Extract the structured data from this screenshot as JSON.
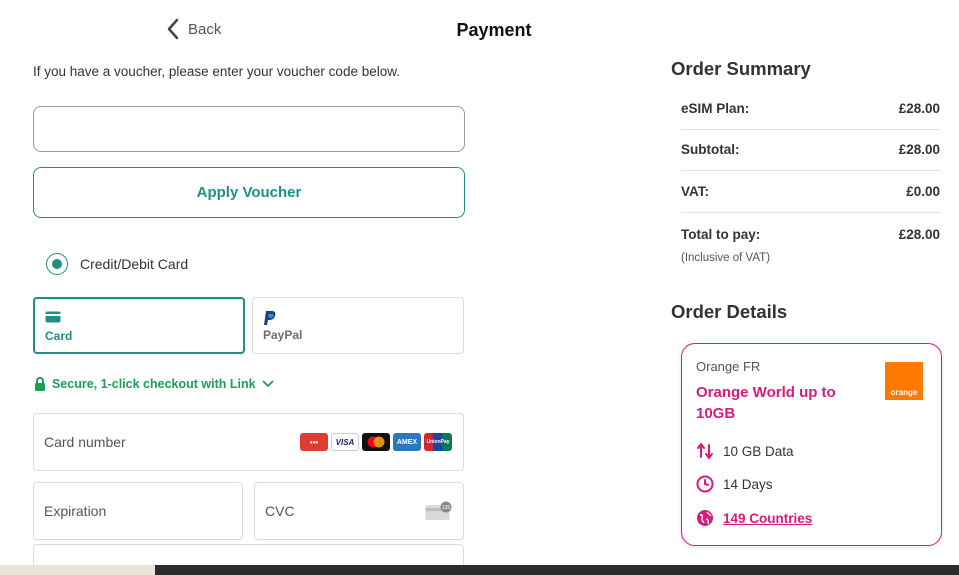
{
  "header": {
    "back_label": "Back",
    "title": "Payment"
  },
  "voucher": {
    "instruction": "If you have a voucher, please enter your voucher code below.",
    "input_value": "",
    "apply_label": "Apply Voucher"
  },
  "payment_method": {
    "radio_label": "Credit/Debit Card",
    "selected": true,
    "tabs": [
      {
        "label": "Card",
        "icon": "card-icon",
        "active": true
      },
      {
        "label": "PayPal",
        "icon": "paypal-icon",
        "active": false
      }
    ],
    "link_checkout_label": "Secure, 1-click checkout with Link",
    "fields": {
      "card_number_label": "Card number",
      "expiration_label": "Expiration",
      "cvc_label": "CVC",
      "cvc_icon_text": "135"
    },
    "card_brands": [
      {
        "name": "mastercard-wallet",
        "text": "•••",
        "color": "#e03c31"
      },
      {
        "name": "visa",
        "text": "VISA",
        "color": "#1a1f71"
      },
      {
        "name": "mastercard",
        "text": "",
        "color": "#111111"
      },
      {
        "name": "amex",
        "text": "AMEX",
        "color": "#2e77bc"
      },
      {
        "name": "unionpay",
        "text": "UnionPay",
        "color": "#d22630"
      }
    ]
  },
  "order_summary": {
    "title": "Order Summary",
    "rows": [
      {
        "label": "eSIM Plan:",
        "value": "£28.00"
      },
      {
        "label": "Subtotal:",
        "value": "£28.00"
      },
      {
        "label": "VAT:",
        "value": "£0.00"
      },
      {
        "label": "Total to pay:",
        "value": "£28.00"
      }
    ],
    "vat_note": "(Inclusive of VAT)"
  },
  "order_details": {
    "title": "Order Details",
    "provider": "Orange FR",
    "plan_name": "Orange World up to 10GB",
    "logo_text": "orange",
    "data": "10 GB Data",
    "duration": "14 Days",
    "countries": "149 Countries"
  },
  "colors": {
    "accent": "#1f8f86",
    "link_green": "#1f9d57",
    "brand_pink": "#d81b7a",
    "orange": "#ff7900"
  }
}
